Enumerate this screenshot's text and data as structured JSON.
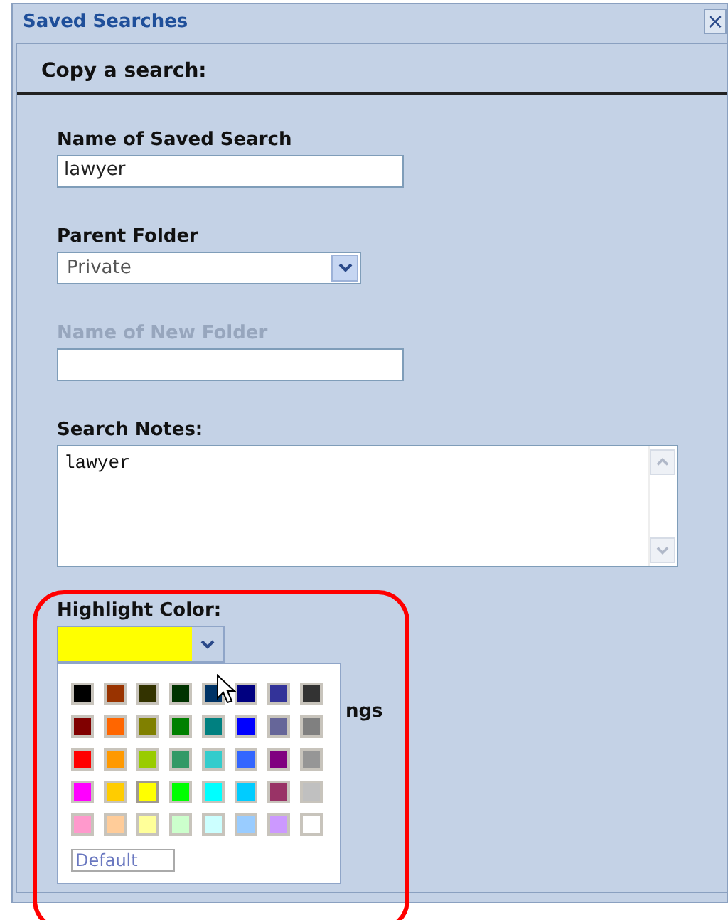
{
  "window": {
    "title": "Saved Searches",
    "close": "×"
  },
  "header": "Copy a search:",
  "fields": [
    {
      "kind": "text",
      "label": "Name of Saved Search",
      "value": "lawyer",
      "disabled": false
    },
    {
      "kind": "select",
      "label": "Parent Folder",
      "value": "Private",
      "disabled": false
    },
    {
      "kind": "text",
      "label": "Name of New Folder",
      "disabled": true
    },
    {
      "kind": "textarea",
      "label": "Search Notes:",
      "value": "lawyer",
      "disabled": false
    }
  ],
  "highlight": {
    "label": "Highlight Color:",
    "expanded": true,
    "default_button": "Default",
    "covered_text": "ngs",
    "swatches": [
      {
        "color": "#000000",
        "selected": false
      },
      {
        "color": "#993300",
        "selected": false
      },
      {
        "color": "#333300",
        "selected": false
      },
      {
        "color": "#003300",
        "selected": false
      },
      {
        "color": "#003366",
        "selected": false
      },
      {
        "color": "#000080",
        "selected": false
      },
      {
        "color": "#333399",
        "selected": false
      },
      {
        "color": "#333333",
        "selected": false
      },
      {
        "color": "#800000",
        "selected": false
      },
      {
        "color": "#ff6600",
        "selected": false
      },
      {
        "color": "#808000",
        "selected": false
      },
      {
        "color": "#008000",
        "selected": false
      },
      {
        "color": "#008080",
        "selected": false
      },
      {
        "color": "#0000ff",
        "selected": false
      },
      {
        "color": "#666699",
        "selected": false
      },
      {
        "color": "#808080",
        "selected": false
      },
      {
        "color": "#ff0000",
        "selected": false
      },
      {
        "color": "#ff9900",
        "selected": false
      },
      {
        "color": "#99cc00",
        "selected": false
      },
      {
        "color": "#339966",
        "selected": false
      },
      {
        "color": "#33cccc",
        "selected": false
      },
      {
        "color": "#3366ff",
        "selected": false
      },
      {
        "color": "#800080",
        "selected": false
      },
      {
        "color": "#969696",
        "selected": false
      },
      {
        "color": "#ff00ff",
        "selected": false
      },
      {
        "color": "#ffcc00",
        "selected": false
      },
      {
        "color": "#ffff00",
        "selected": true
      },
      {
        "color": "#00ff00",
        "selected": false
      },
      {
        "color": "#00ffff",
        "selected": false
      },
      {
        "color": "#00ccff",
        "selected": false
      },
      {
        "color": "#993366",
        "selected": false
      },
      {
        "color": "#c0c0c0",
        "selected": false
      },
      {
        "color": "#ff99cc",
        "selected": false
      },
      {
        "color": "#ffcc99",
        "selected": false
      },
      {
        "color": "#ffff99",
        "selected": false
      },
      {
        "color": "#ccffcc",
        "selected": false
      },
      {
        "color": "#ccffff",
        "selected": false
      },
      {
        "color": "#99ccff",
        "selected": false
      },
      {
        "color": "#cc99ff",
        "selected": false
      },
      {
        "color": "#ffffff",
        "selected": false
      }
    ]
  }
}
